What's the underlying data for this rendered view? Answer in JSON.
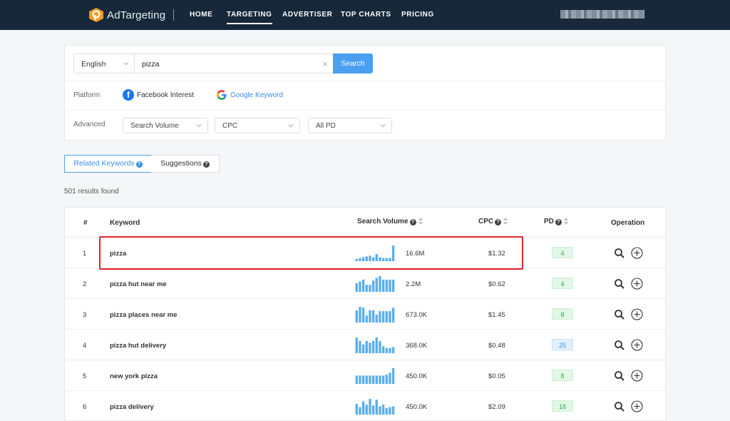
{
  "nav": {
    "brand": "AdTargeting",
    "items": [
      {
        "label": "HOME",
        "active": false
      },
      {
        "label": "TARGETING",
        "active": true
      },
      {
        "label": "ADVERTISER",
        "active": false
      },
      {
        "label": "TOP CHARTS",
        "active": false
      },
      {
        "label": "PRICING",
        "active": false
      }
    ]
  },
  "search": {
    "language": "English",
    "query": "pizza",
    "button": "Search"
  },
  "platform": {
    "label": "Platform",
    "options": [
      "Facebook Interest",
      "Google Keyword"
    ]
  },
  "advanced": {
    "label": "Advanced",
    "filters": [
      "Search Volume",
      "CPC",
      "All PD"
    ]
  },
  "tabs": [
    "Related Keywords",
    "Suggestions"
  ],
  "results_text": "501 results found",
  "table": {
    "headers": {
      "index": "#",
      "keyword": "Keyword",
      "volume": "Search Volume",
      "cpc": "CPC",
      "pd": "PD",
      "operation": "Operation"
    },
    "rows": [
      {
        "index": "1",
        "keyword": "pizza",
        "volume": "16.6M",
        "cpc": "$1.32",
        "pd": "4",
        "pd_color": "green",
        "trend": [
          3,
          4,
          5,
          6,
          7,
          5,
          9,
          5,
          4,
          4,
          4,
          20
        ]
      },
      {
        "index": "2",
        "keyword": "pizza hut near me",
        "volume": "2.2M",
        "cpc": "$0.62",
        "pd": "4",
        "pd_color": "green",
        "trend": [
          10,
          12,
          14,
          8,
          8,
          13,
          16,
          18,
          14,
          14,
          14,
          14
        ]
      },
      {
        "index": "3",
        "keyword": "pizza places near me",
        "volume": "673.0K",
        "cpc": "$1.45",
        "pd": "8",
        "pd_color": "green",
        "trend": [
          14,
          18,
          17,
          8,
          14,
          14,
          9,
          13,
          13,
          13,
          13,
          17
        ]
      },
      {
        "index": "4",
        "keyword": "pizza hut delivery",
        "volume": "368.0K",
        "cpc": "$0.48",
        "pd": "25",
        "pd_color": "blue",
        "trend": [
          18,
          14,
          10,
          14,
          12,
          14,
          18,
          14,
          8,
          6,
          6,
          7
        ]
      },
      {
        "index": "5",
        "keyword": "new york pizza",
        "volume": "450.0K",
        "cpc": "$0.05",
        "pd": "8",
        "pd_color": "green",
        "trend": [
          9,
          9,
          9,
          9,
          9,
          9,
          9,
          9,
          9,
          10,
          12,
          17
        ]
      },
      {
        "index": "6",
        "keyword": "pizza delivery",
        "volume": "450.0K",
        "cpc": "$2.09",
        "pd": "18",
        "pd_color": "green",
        "trend": [
          13,
          9,
          16,
          12,
          19,
          11,
          18,
          10,
          12,
          8,
          9,
          10
        ]
      }
    ]
  },
  "colors": {
    "nav_bg": "#16283a",
    "accent": "#4a9ff0",
    "bar": "#5aaeea",
    "highlight": "#e0232d"
  }
}
